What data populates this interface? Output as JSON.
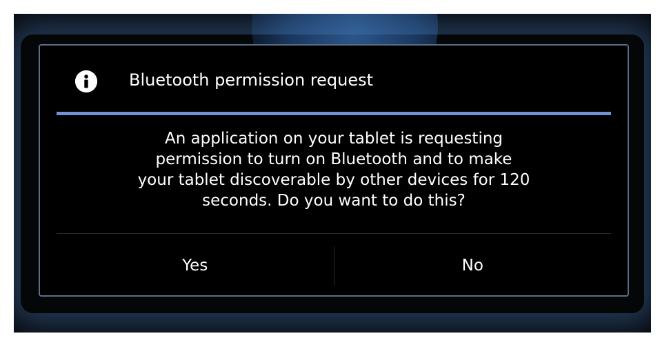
{
  "dialog": {
    "title": "Bluetooth permission request",
    "title_icon": "info-icon",
    "message": "An application on your tablet is requesting permission to turn on Bluetooth and to make your tablet discoverable by other devices for 120 seconds. Do you want to do this?",
    "message_lines": [
      "An application on your tablet is requesting",
      "permission to turn on Bluetooth and to make",
      "your tablet discoverable by other devices for 120",
      "seconds. Do you want to do this?"
    ],
    "buttons": {
      "yes_label": "Yes",
      "no_label": "No"
    }
  },
  "colors": {
    "accent_divider": "#6f92d6",
    "dialog_background": "#000000",
    "text": "#ffffff"
  }
}
